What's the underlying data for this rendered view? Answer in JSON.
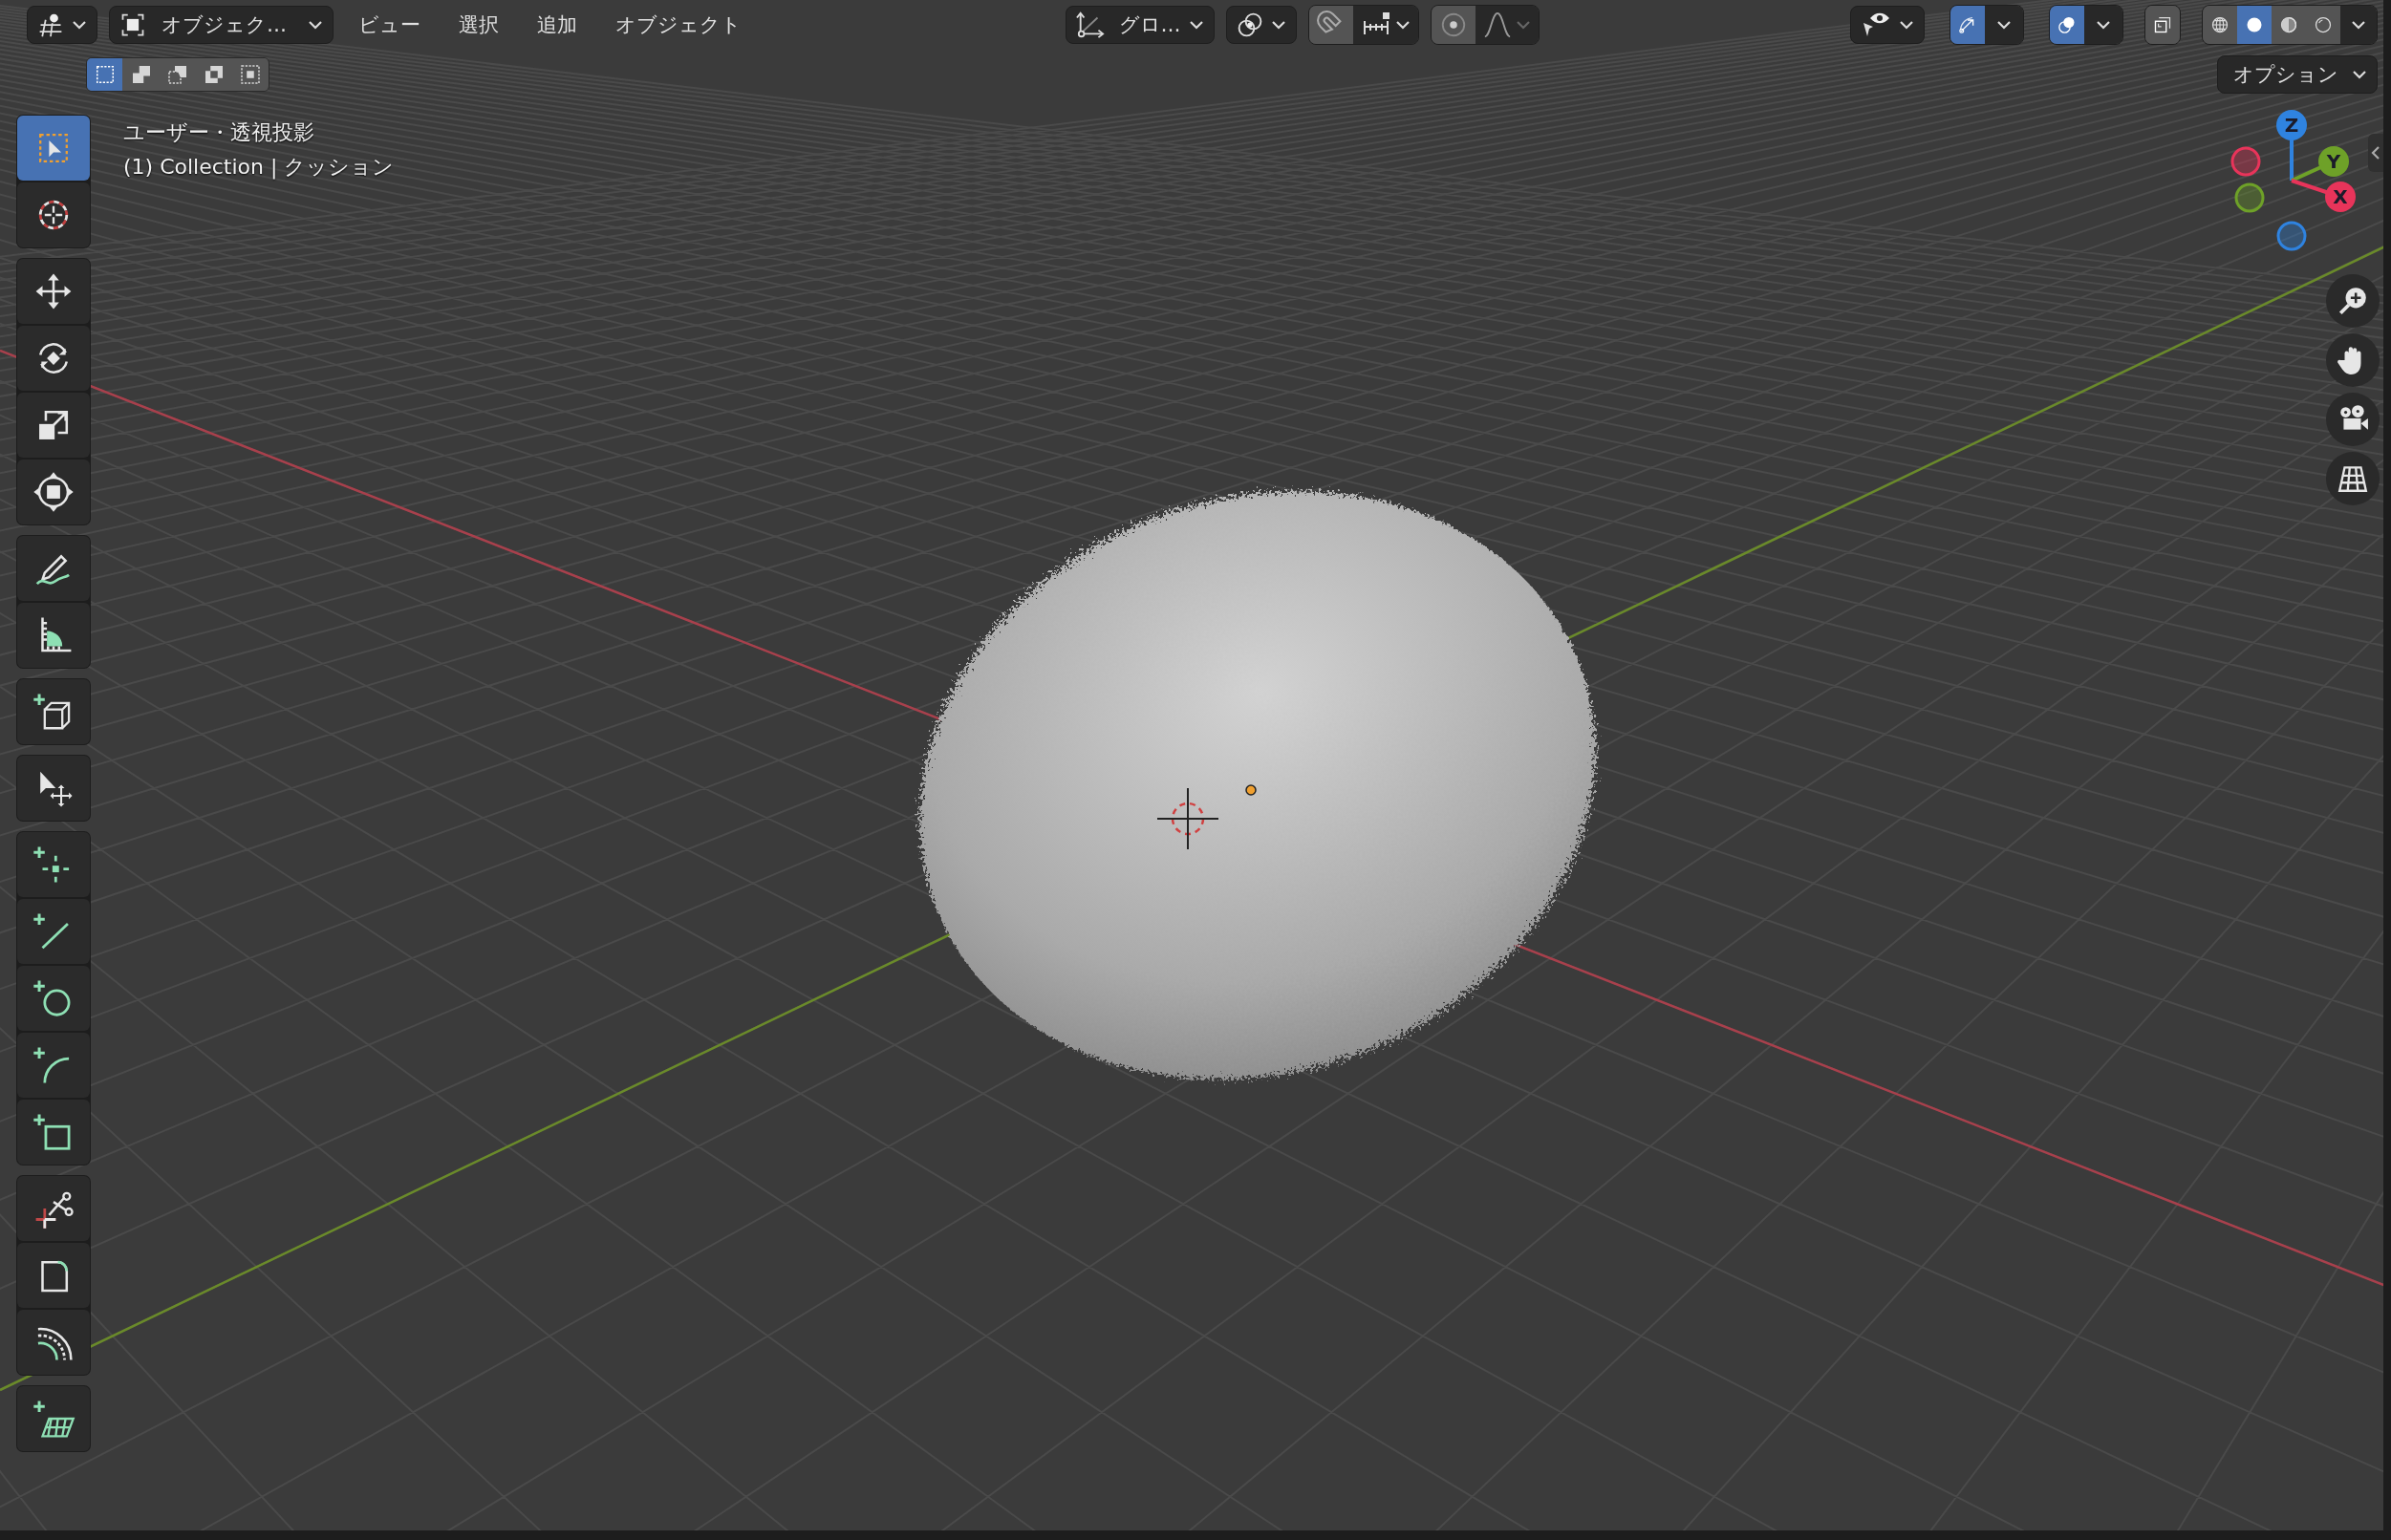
{
  "header": {
    "mode": {
      "label": "オブジェク…"
    },
    "menus": [
      {
        "label": "ビュー"
      },
      {
        "label": "選択"
      },
      {
        "label": "追加"
      },
      {
        "label": "オブジェクト"
      }
    ],
    "transform_orientation": {
      "label": "グロ…"
    },
    "gizmos": {
      "on": true
    },
    "overlays": {
      "on": true
    },
    "xray": {
      "on": false
    },
    "shading_modes": [
      {
        "kind": "wireframe",
        "selected": false
      },
      {
        "kind": "solid",
        "selected": true
      },
      {
        "kind": "material",
        "selected": false
      },
      {
        "kind": "rendered",
        "selected": false
      }
    ]
  },
  "select_modes": [
    {
      "kind": "new",
      "selected": true
    },
    {
      "kind": "extend",
      "selected": false
    },
    {
      "kind": "subtract",
      "selected": false
    },
    {
      "kind": "invert",
      "selected": false
    },
    {
      "kind": "intersect",
      "selected": false
    }
  ],
  "options": {
    "label": "オプション"
  },
  "viewport_info": {
    "view_name": "ユーザー・透視投影",
    "object_info": "(1) Collection | クッション"
  },
  "toolbar": [
    {
      "tools": [
        {
          "kind": "select_box",
          "selected": true
        },
        {
          "kind": "cursor",
          "selected": false
        }
      ]
    },
    {
      "tools": [
        {
          "kind": "move",
          "selected": false
        },
        {
          "kind": "rotate",
          "selected": false
        },
        {
          "kind": "scale",
          "selected": false
        },
        {
          "kind": "transform",
          "selected": false
        }
      ]
    },
    {
      "tools": [
        {
          "kind": "annotate",
          "selected": false
        },
        {
          "kind": "measure",
          "selected": false
        }
      ]
    },
    {
      "tools": [
        {
          "kind": "add_cube",
          "selected": false
        }
      ]
    },
    {
      "tools": [
        {
          "kind": "extrude",
          "selected": false
        }
      ]
    },
    {
      "tools": [
        {
          "kind": "add_point",
          "selected": false
        },
        {
          "kind": "add_line",
          "selected": false
        },
        {
          "kind": "add_circle",
          "selected": false
        },
        {
          "kind": "add_arc",
          "selected": false
        },
        {
          "kind": "add_rect",
          "selected": false
        }
      ]
    },
    {
      "tools": [
        {
          "kind": "knife",
          "selected": false
        },
        {
          "kind": "corner",
          "selected": false
        },
        {
          "kind": "spin",
          "selected": false
        }
      ]
    },
    {
      "tools": [
        {
          "kind": "add_grid",
          "selected": false
        }
      ]
    }
  ],
  "nav_gizmo": {
    "axes": [
      {
        "label": "Z",
        "color": "#2f83e0"
      },
      {
        "label": "Y",
        "color": "#6ea128"
      },
      {
        "label": "X",
        "color": "#e8345a"
      }
    ]
  }
}
